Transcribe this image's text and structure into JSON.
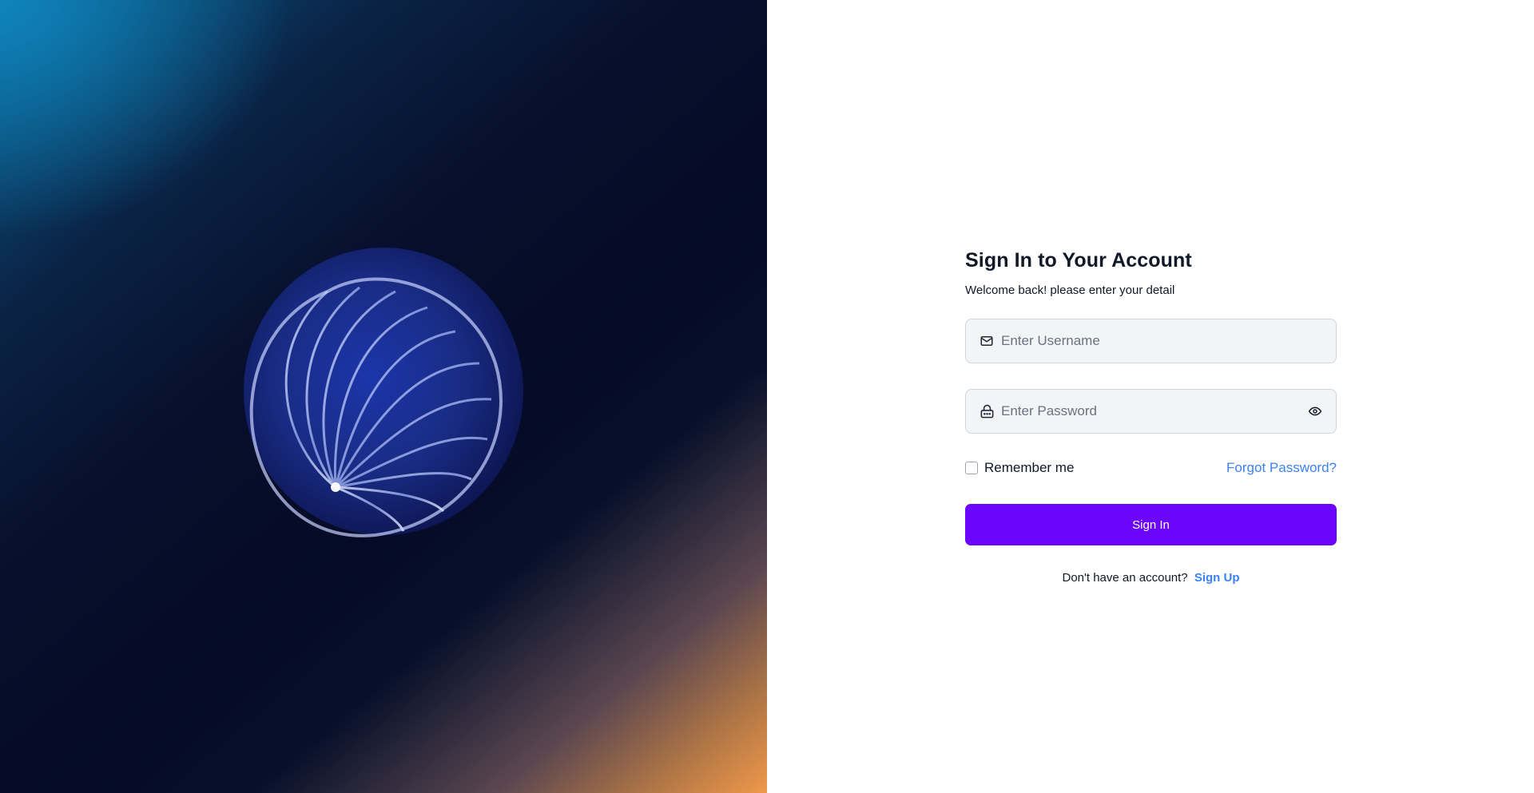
{
  "hero": {
    "art_icon": "glass-shell-sphere-illustration"
  },
  "form": {
    "title": "Sign In to Your Account",
    "subtitle": "Welcome back! please enter your detail",
    "username": {
      "value": "",
      "placeholder": "Enter Username",
      "icon": "mail-icon"
    },
    "password": {
      "value": "",
      "placeholder": "Enter Password",
      "icon": "lock-icon",
      "toggle_icon": "eye-icon"
    },
    "remember_label": "Remember me",
    "remember_checked": false,
    "forgot_label": "Forgot Password?",
    "submit_label": "Sign In",
    "signup_prompt": "Don't have an account?",
    "signup_link": "Sign Up"
  },
  "colors": {
    "primary": "#6b05fb",
    "link": "#3b82f6",
    "text": "#111827",
    "input_bg": "#f3f4f6"
  }
}
